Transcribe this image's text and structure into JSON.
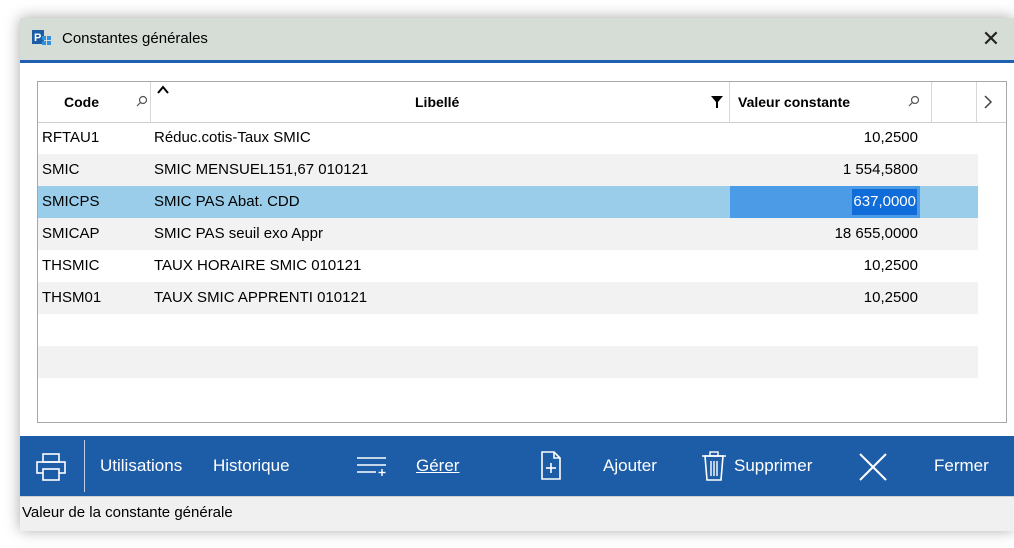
{
  "window": {
    "title": "Constantes générales"
  },
  "columns": {
    "code": "Code",
    "libelle": "Libellé",
    "valeur": "Valeur constante"
  },
  "rows": [
    {
      "code": "RFTAU1",
      "libelle": "Réduc.cotis-Taux SMIC",
      "valeur": "10,2500"
    },
    {
      "code": "SMIC",
      "libelle": "SMIC MENSUEL151,67 010121",
      "valeur": "1 554,5800"
    },
    {
      "code": "SMICPS",
      "libelle": "SMIC PAS Abat. CDD",
      "valeur": "637,0000"
    },
    {
      "code": "SMICAP",
      "libelle": "SMIC PAS seuil exo Appr",
      "valeur": "18 655,0000"
    },
    {
      "code": "THSMIC",
      "libelle": "TAUX HORAIRE SMIC 010121",
      "valeur": "10,2500"
    },
    {
      "code": "THSM01",
      "libelle": "TAUX SMIC APPRENTI 010121",
      "valeur": "10,2500"
    }
  ],
  "toolbar": {
    "utilisations": "Utilisations",
    "historique": "Historique",
    "gerer": "Gérer",
    "ajouter": "Ajouter",
    "supprimer": "Supprimer",
    "fermer": "Fermer"
  },
  "status": "Valeur de la constante générale",
  "colors": {
    "accent": "#1d5ca6",
    "selection": "#99cdea",
    "editing": "#0f6cd8"
  }
}
